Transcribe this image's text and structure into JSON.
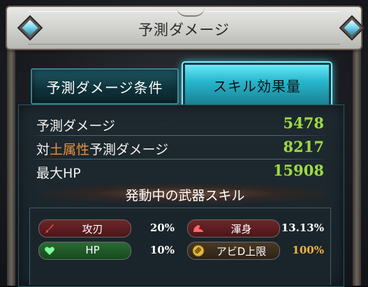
{
  "header": {
    "title": "予測ダメージ"
  },
  "tabs": [
    {
      "label": "予測ダメージ条件",
      "active": false
    },
    {
      "label": "スキル効果量",
      "active": true
    }
  ],
  "stats": {
    "damage": {
      "label": "予測ダメージ",
      "value": "5478"
    },
    "element_damage": {
      "label_prefix": "対",
      "label_element": "土属性",
      "label_suffix": "予測ダメージ",
      "value": "8217"
    },
    "max_hp": {
      "label": "最大HP",
      "value": "15908"
    }
  },
  "weapon_skills": {
    "heading": "発動中の武器スキル",
    "items": [
      {
        "name": "攻刃",
        "value": "20%",
        "icon": "sword-icon",
        "color": "#6e2629"
      },
      {
        "name": "渾身",
        "value": "13.13%",
        "icon": "flexed-arm-icon",
        "color": "#6e2629"
      },
      {
        "name": "HP",
        "value": "10%",
        "icon": "heart-icon",
        "color": "#2b6a33"
      },
      {
        "name": "アビD上限",
        "value": "100%",
        "icon": "ability-orb-icon",
        "color": "#4a3a24",
        "value_color": "#f2b338"
      }
    ]
  },
  "colors": {
    "accent_cyan": "#4de6ff",
    "value_green": "#9fd84a",
    "earth_orange": "#e8913e"
  }
}
